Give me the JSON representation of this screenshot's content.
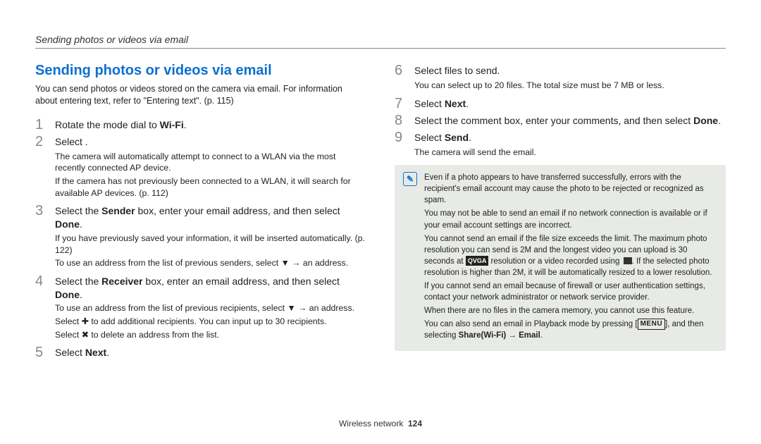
{
  "header": {
    "running_title": "Sending photos or videos via email"
  },
  "title": "Sending photos or videos via email",
  "intro": "You can send photos or videos stored on the camera via email. For information about entering text, refer to \"Entering text\". (p. 115)",
  "left_steps": {
    "s1": {
      "num": "1",
      "text_pre": "Rotate the mode dial to ",
      "wifi": "Wi-Fi",
      "text_post": "."
    },
    "s2": {
      "num": "2",
      "text": "Select       .",
      "sub1": "The camera will automatically attempt to connect to a WLAN via the most recently connected AP device.",
      "sub2": "If the camera has not previously been connected to a WLAN, it will search for available AP devices. (p. 112)"
    },
    "s3": {
      "num": "3",
      "text_a": "Select the ",
      "bold_a": "Sender",
      "text_b": " box, enter your email address, and then select ",
      "bold_b": "Done",
      "text_c": ".",
      "sub1": "If you have previously saved your information, it will be inserted automatically. (p. 122)",
      "sub2_a": "To use an address from the list of previous senders, select ",
      "arrow": "▼",
      "sub2_b": " → an address."
    },
    "s4": {
      "num": "4",
      "text_a": "Select the ",
      "bold_a": "Receiver",
      "text_b": " box, enter an email address, and then select ",
      "bold_b": "Done",
      "text_c": ".",
      "sub1_a": "To use an address from the list of previous recipients, select ",
      "arrow": "▼",
      "sub1_b": " → an address.",
      "sub2_a": "Select ",
      "plus": "✚",
      "sub2_b": " to add additional recipients. You can input up to 30 recipients.",
      "sub3_a": "Select ",
      "x": "✖",
      "sub3_b": " to delete an address from the list."
    },
    "s5": {
      "num": "5",
      "text_a": "Select ",
      "bold_a": "Next",
      "text_b": "."
    }
  },
  "right_steps": {
    "s6": {
      "num": "6",
      "text": "Select files to send.",
      "sub1": "You can select up to 20 files. The total size must be 7 MB or less."
    },
    "s7": {
      "num": "7",
      "text_a": "Select ",
      "bold_a": "Next",
      "text_b": "."
    },
    "s8": {
      "num": "8",
      "text_a": "Select the comment box, enter your comments, and then select ",
      "bold_a": "Done",
      "text_b": "."
    },
    "s9": {
      "num": "9",
      "text_a": "Select ",
      "bold_a": "Send",
      "text_b": ".",
      "sub1": "The camera will send the email."
    }
  },
  "notes": {
    "n1": "Even if a photo appears to have transferred successfully, errors with the recipient's email account may cause the photo to be rejected or recognized as spam.",
    "n2": "You may not be able to send an email if no network connection is available or if your email account settings are incorrect.",
    "n3_a": "You cannot send an email if the file size exceeds the limit. The maximum photo resolution you can send is 2M and the longest video you can upload is 30 seconds at ",
    "n3_qvga": "QVGA",
    "n3_b": " resolution or a video recorded using ",
    "n3_c": ". If the selected photo resolution is higher than 2M, it will be automatically resized to a lower resolution.",
    "n4": "If you cannot send an email because of firewall or user authentication settings, contact your network administrator or network service provider.",
    "n5": "When there are no files in the camera memory, you cannot use this feature.",
    "n6_a": "You can also send an email in Playback mode by pressing [",
    "n6_menu": "MENU",
    "n6_b": "], and then selecting ",
    "n6_bold": "Share(Wi-Fi) → Email",
    "n6_c": "."
  },
  "footer": {
    "section": "Wireless network",
    "page": "124"
  }
}
